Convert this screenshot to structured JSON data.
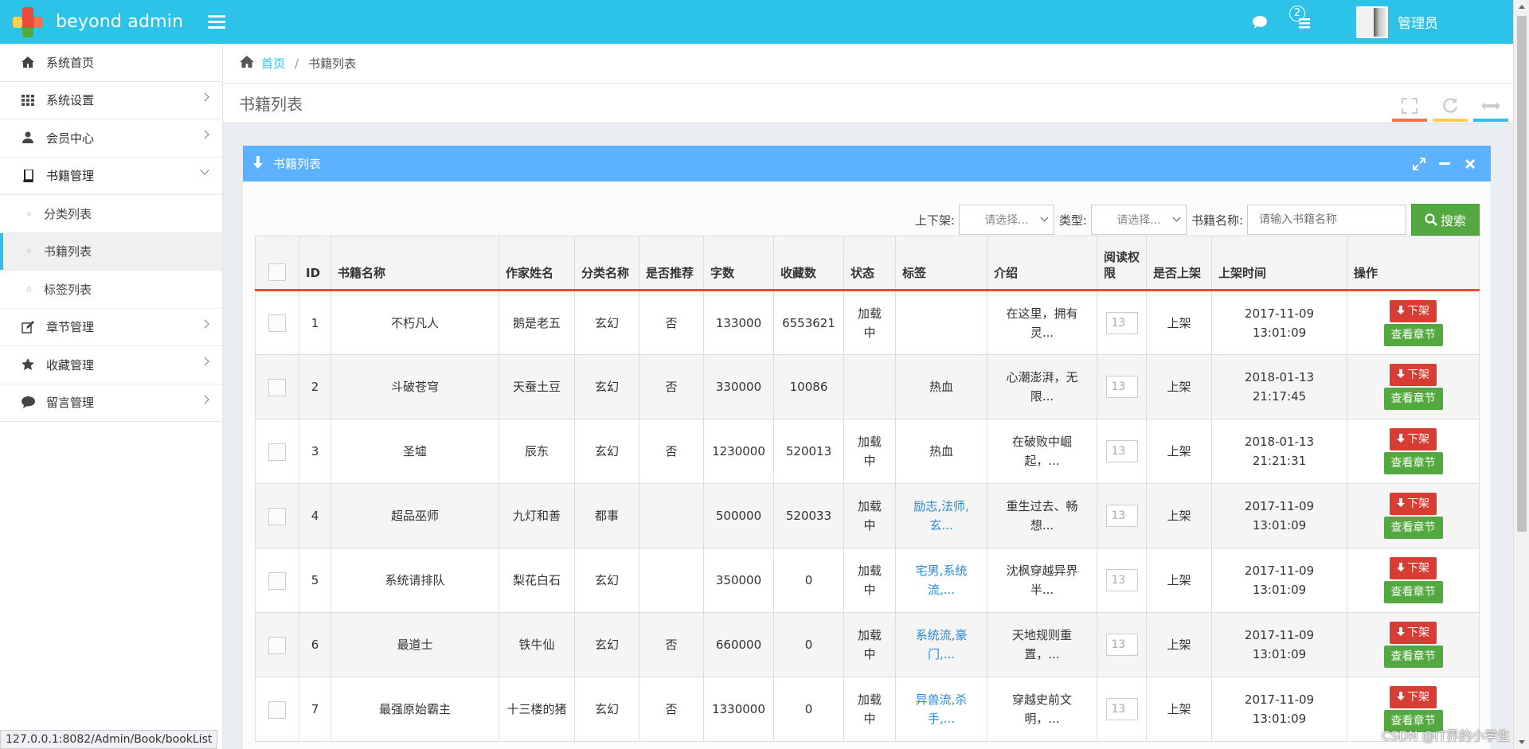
{
  "navbar": {
    "logo_text": "beyond admin",
    "notification_count": "2",
    "user_name": "管理员",
    "brand_color": "#2dc3e8"
  },
  "sidebar": {
    "items": [
      {
        "label": "系统首页",
        "icon": "home-icon"
      },
      {
        "label": "系统设置",
        "icon": "grid-icon"
      },
      {
        "label": "会员中心",
        "icon": "user-icon"
      },
      {
        "label": "书籍管理",
        "icon": "book-icon"
      },
      {
        "label": "章节管理",
        "icon": "edit-icon"
      },
      {
        "label": "收藏管理",
        "icon": "star-icon"
      },
      {
        "label": "留言管理",
        "icon": "comment-icon"
      }
    ],
    "submenu": [
      {
        "label": "分类列表"
      },
      {
        "label": "书籍列表"
      },
      {
        "label": "标签列表"
      }
    ]
  },
  "breadcrumb": {
    "home": "首页",
    "separator": "/",
    "current": "书籍列表"
  },
  "page": {
    "title": "书籍列表"
  },
  "widget": {
    "title": "书籍列表",
    "header_color": "#5db2ff"
  },
  "search": {
    "shelf_label": "上下架:",
    "shelf_value": "请选择...",
    "type_label": "类型:",
    "type_value": "请选择...",
    "name_label": "书籍名称:",
    "name_placeholder": "请输入书籍名称",
    "button_label": "搜索"
  },
  "table": {
    "headers": [
      "",
      "ID",
      "书籍名称",
      "作家姓名",
      "分类名称",
      "是否推荐",
      "字数",
      "收藏数",
      "状态",
      "标签",
      "介绍",
      "阅读权限",
      "是否上架",
      "上架时间",
      "操作"
    ],
    "rows": [
      {
        "id": "1",
        "name": "不朽凡人",
        "author": "鹅是老五",
        "category": "玄幻",
        "recommend": "否",
        "words": "133000",
        "favorites": "6553621",
        "status": "加载中",
        "tags": "",
        "intro": "在这里，拥有灵...",
        "permission": "13",
        "shelf": "上架",
        "date": "2017-11-09",
        "time": "13:01:09"
      },
      {
        "id": "2",
        "name": "斗破苍穹",
        "author": "天蚕土豆",
        "category": "玄幻",
        "recommend": "否",
        "words": "330000",
        "favorites": "10086",
        "status": "",
        "tags": "热血",
        "intro": "心潮澎湃，无限...",
        "permission": "13",
        "shelf": "上架",
        "date": "2018-01-13",
        "time": "21:17:45"
      },
      {
        "id": "3",
        "name": "圣墟",
        "author": "辰东",
        "category": "玄幻",
        "recommend": "否",
        "words": "1230000",
        "favorites": "520013",
        "status": "加载中",
        "tags": "热血",
        "intro": "在破败中崛起，...",
        "permission": "13",
        "shelf": "上架",
        "date": "2018-01-13",
        "time": "21:21:31"
      },
      {
        "id": "4",
        "name": "超品巫师",
        "author": "九灯和善",
        "category": "都事",
        "recommend": "",
        "words": "500000",
        "favorites": "520033",
        "status": "加载中",
        "tags": "励志,法师,玄...",
        "intro": "重生过去、畅想...",
        "permission": "13",
        "shelf": "上架",
        "date": "2017-11-09",
        "time": "13:01:09"
      },
      {
        "id": "5",
        "name": "系统请排队",
        "author": "梨花白石",
        "category": "玄幻",
        "recommend": "",
        "words": "350000",
        "favorites": "0",
        "status": "加载中",
        "tags": "宅男,系统流,...",
        "intro": "沈枫穿越异界半...",
        "permission": "13",
        "shelf": "上架",
        "date": "2017-11-09",
        "time": "13:01:09"
      },
      {
        "id": "6",
        "name": "最道士",
        "author": "铁牛仙",
        "category": "玄幻",
        "recommend": "否",
        "words": "660000",
        "favorites": "0",
        "status": "加载中",
        "tags": "系统流,豪门,...",
        "intro": "天地规则重置，...",
        "permission": "13",
        "shelf": "上架",
        "date": "2017-11-09",
        "time": "13:01:09"
      },
      {
        "id": "7",
        "name": "最强原始霸主",
        "author": "十三楼的猪",
        "category": "玄幻",
        "recommend": "否",
        "words": "1330000",
        "favorites": "0",
        "status": "加载中",
        "tags": "异兽流,杀手,...",
        "intro": "穿越史前文明，...",
        "permission": "13",
        "shelf": "上架",
        "date": "2017-11-09",
        "time": "13:01:09"
      }
    ],
    "action_down_label": "下架",
    "action_chapter_label": "查看章节"
  },
  "statusbar": {
    "url": "127.0.0.1:8082/Admin/Book/bookList"
  },
  "watermark": "CSDN @IT界的小学生"
}
